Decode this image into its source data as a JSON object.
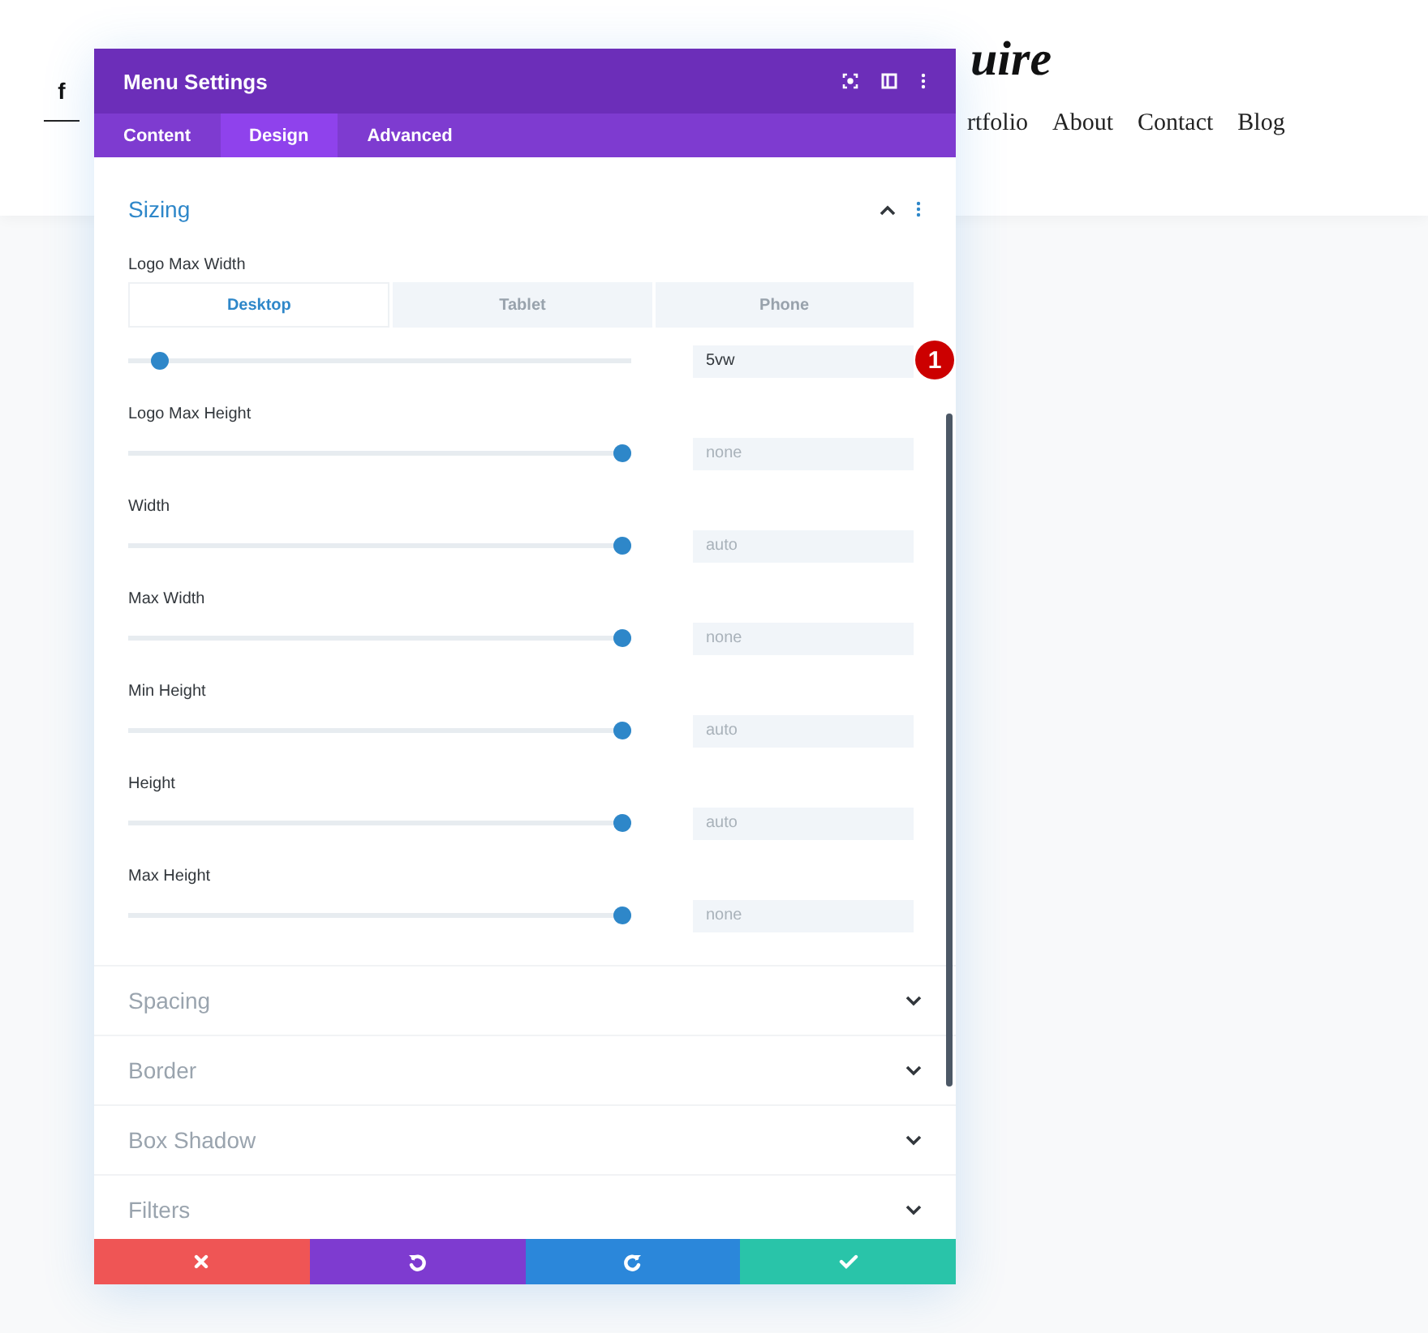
{
  "site": {
    "social_icon": "f",
    "logo": "uire",
    "nav": [
      {
        "label": "rtfolio"
      },
      {
        "label": "About"
      },
      {
        "label": "Contact"
      },
      {
        "label": "Blog"
      }
    ]
  },
  "window": {
    "title": "Menu Settings"
  },
  "tabs": [
    {
      "label": "Content",
      "selected": false
    },
    {
      "label": "Design",
      "selected": true
    },
    {
      "label": "Advanced",
      "selected": false
    }
  ],
  "sections": [
    {
      "title": "Sizing",
      "expanded": true,
      "fields": [
        {
          "label": "Logo Max Width",
          "devices": [
            {
              "label": "Desktop",
              "selected": true
            },
            {
              "label": "Tablet",
              "selected": false
            },
            {
              "label": "Phone",
              "selected": false
            }
          ],
          "level": 0.06,
          "value": "5vw",
          "badge": "1"
        },
        {
          "label": "Logo Max Height",
          "level": 0.98,
          "placeholder": "none"
        },
        {
          "label": "Width",
          "level": 0.98,
          "placeholder": "auto"
        },
        {
          "label": "Max Width",
          "level": 0.98,
          "placeholder": "none"
        },
        {
          "label": "Min Height",
          "level": 0.98,
          "placeholder": "auto"
        },
        {
          "label": "Height",
          "level": 0.98,
          "placeholder": "auto"
        },
        {
          "label": "Max Height",
          "level": 0.98,
          "placeholder": "none"
        }
      ]
    },
    {
      "title": "Spacing",
      "expanded": false
    },
    {
      "title": "Border",
      "expanded": false
    },
    {
      "title": "Box Shadow",
      "expanded": false
    },
    {
      "title": "Filters",
      "expanded": false
    }
  ],
  "footer_buttons": [
    {
      "kind": "cancel"
    },
    {
      "kind": "undo"
    },
    {
      "kind": "redo"
    },
    {
      "kind": "save"
    }
  ]
}
